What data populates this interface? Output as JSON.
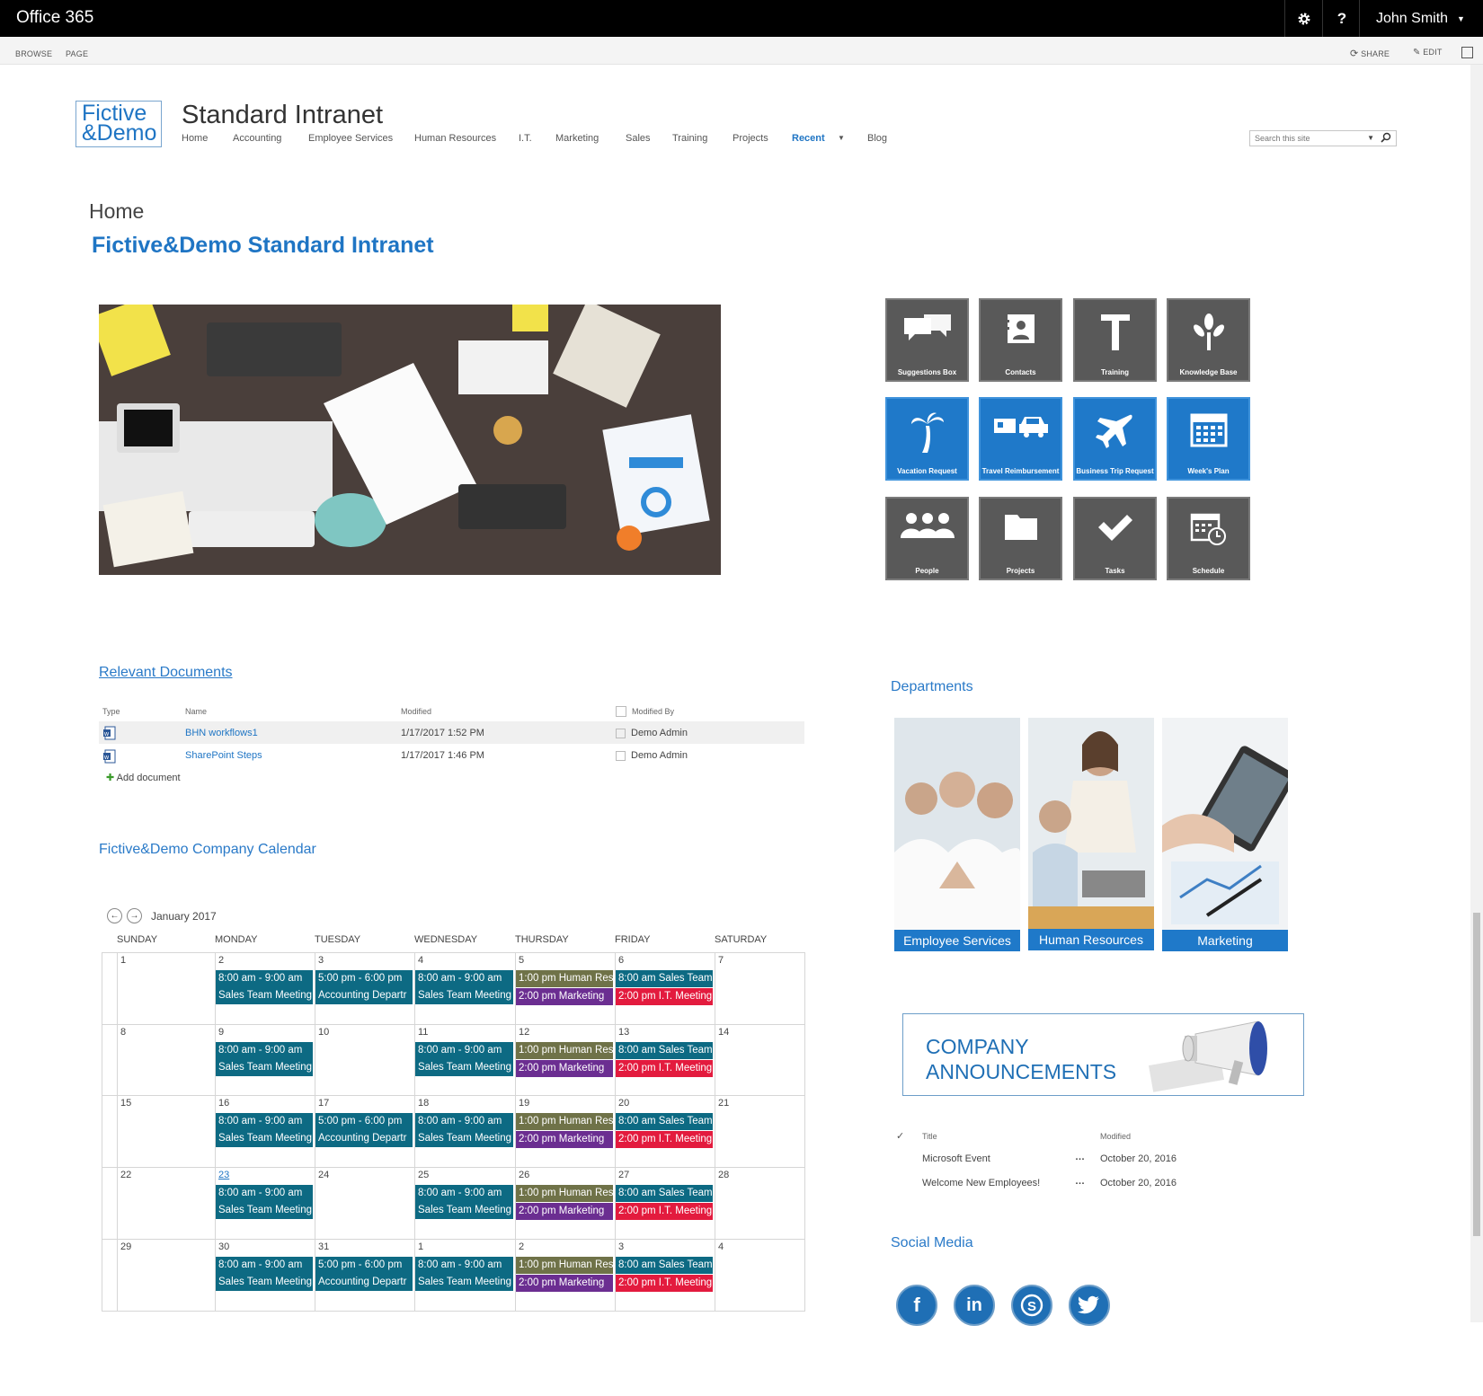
{
  "suitebar": {
    "brand": "Office 365",
    "settings_icon": "gear-icon",
    "help_label": "?",
    "user_name": "John Smith"
  },
  "ribbon": {
    "tabs": [
      "BROWSE",
      "PAGE"
    ],
    "share": "SHARE",
    "edit": "EDIT"
  },
  "site": {
    "logo_line1": "Fictive",
    "logo_line2": "&Demo",
    "title": "Standard Intranet",
    "nav": [
      "Home",
      "Accounting",
      "Employee Services",
      "Human Resources",
      "I.T.",
      "Marketing",
      "Sales",
      "Training",
      "Projects",
      "Recent",
      "Blog"
    ],
    "search_placeholder": "Search this site"
  },
  "page": {
    "crumb": "Home",
    "title": "Fictive&Demo Standard Intranet"
  },
  "tiles": [
    {
      "label": "Suggestions Box",
      "icon": "chat-bubbles-icon",
      "color": "gray"
    },
    {
      "label": "Contacts",
      "icon": "contact-card-icon",
      "color": "gray"
    },
    {
      "label": "Training",
      "icon": "letter-t-icon",
      "color": "gray"
    },
    {
      "label": "Knowledge Base",
      "icon": "tree-icon",
      "color": "gray"
    },
    {
      "label": "Vacation Request",
      "icon": "palm-tree-icon",
      "color": "blue"
    },
    {
      "label": "Travel Reimbursement",
      "icon": "car-icon",
      "color": "blue"
    },
    {
      "label": "Business Trip Request",
      "icon": "airplane-icon",
      "color": "blue"
    },
    {
      "label": "Week's Plan",
      "icon": "calendar-icon",
      "color": "blue"
    },
    {
      "label": "People",
      "icon": "people-icon",
      "color": "gray"
    },
    {
      "label": "Projects",
      "icon": "folder-icon",
      "color": "gray"
    },
    {
      "label": "Tasks",
      "icon": "checkmark-icon",
      "color": "gray"
    },
    {
      "label": "Schedule",
      "icon": "calendar-clock-icon",
      "color": "gray"
    }
  ],
  "documents": {
    "title": "Relevant Documents",
    "columns": [
      "Type",
      "Name",
      "Modified",
      "Modified By"
    ],
    "rows": [
      {
        "name": "BHN workflows1",
        "modified": "1/17/2017 1:52 PM",
        "modified_by": "Demo Admin"
      },
      {
        "name": "SharePoint Steps",
        "modified": "1/17/2017 1:46 PM",
        "modified_by": "Demo Admin"
      }
    ],
    "add": "Add document"
  },
  "calendar": {
    "title": "Fictive&Demo Company Calendar",
    "month": "January 2017",
    "days": [
      "SUNDAY",
      "MONDAY",
      "TUESDAY",
      "WEDNESDAY",
      "THURSDAY",
      "FRIDAY",
      "SATURDAY"
    ],
    "weeks": [
      [
        "1",
        "2",
        "3",
        "4",
        "5",
        "6",
        "7"
      ],
      [
        "8",
        "9",
        "10",
        "11",
        "12",
        "13",
        "14"
      ],
      [
        "15",
        "16",
        "17",
        "18",
        "19",
        "20",
        "21"
      ],
      [
        "22",
        "23",
        "24",
        "25",
        "26",
        "27",
        "28"
      ],
      [
        "29",
        "30",
        "31",
        "1",
        "2",
        "3",
        "4"
      ]
    ],
    "events": {
      "mon_time": "8:00 am - 9:00 am",
      "mon_title": "Sales Team Meeting",
      "tue_time": "5:00 pm - 6:00 pm",
      "tue_title": "Accounting Departr",
      "thu_1": "1:00 pm Human Res",
      "thu_2": "2:00 pm Marketing",
      "fri_1": "8:00 am Sales Team",
      "fri_2": "2:00 pm I.T. Meeting"
    }
  },
  "departments": {
    "title": "Departments",
    "items": [
      "Employee Services",
      "Human Resources",
      "Marketing"
    ]
  },
  "announcements": {
    "banner_line1": "COMPANY",
    "banner_line2": "ANNOUNCEMENTS",
    "columns": [
      "Title",
      "Modified"
    ],
    "rows": [
      {
        "title": "Microsoft Event",
        "modified": "October 20, 2016"
      },
      {
        "title": "Welcome New Employees!",
        "modified": "October 20, 2016"
      }
    ]
  },
  "social": {
    "title": "Social Media",
    "icons": [
      "facebook-icon",
      "linkedin-icon",
      "skype-icon",
      "twitter-icon"
    ]
  },
  "colors": {
    "accent": "#1f79c9",
    "tile_gray": "#595959",
    "event_teal": "#0d6a83",
    "event_olive": "#6f7248",
    "event_purple": "#6b2e91",
    "event_red": "#e31b3e"
  }
}
